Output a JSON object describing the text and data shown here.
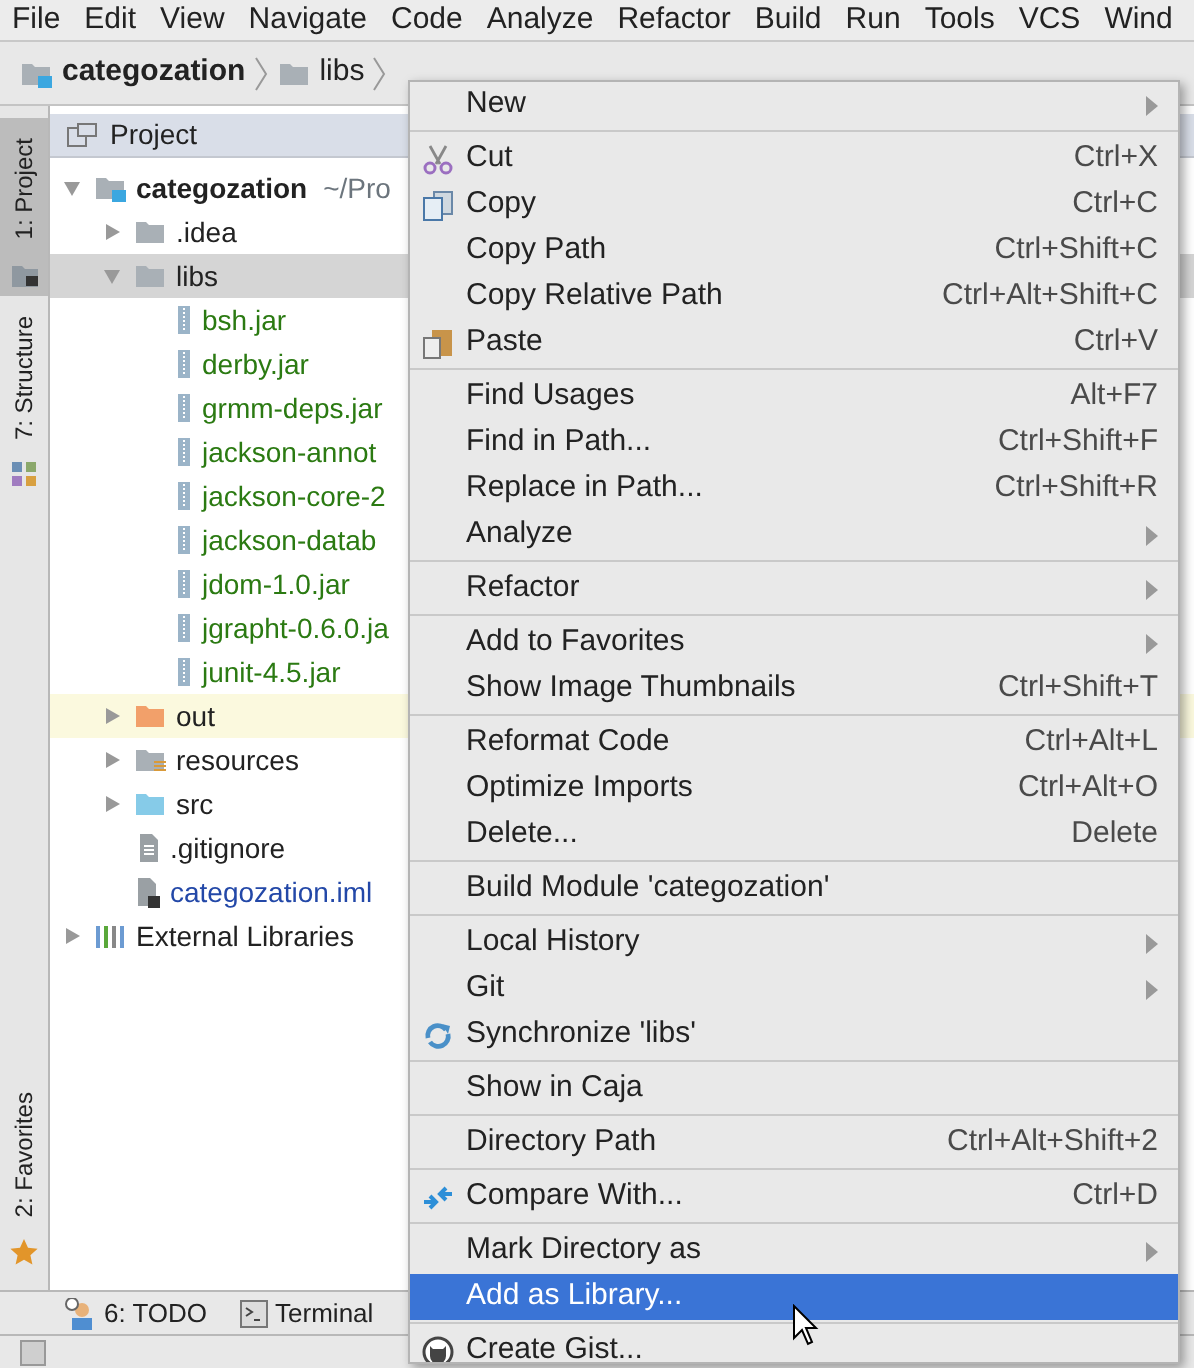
{
  "menu_bar": [
    "File",
    "Edit",
    "View",
    "Navigate",
    "Code",
    "Analyze",
    "Refactor",
    "Build",
    "Run",
    "Tools",
    "VCS",
    "Wind"
  ],
  "breadcrumb": [
    {
      "label": "categozation",
      "kind": "project"
    },
    {
      "label": "libs",
      "kind": "folder"
    }
  ],
  "tool_strip": [
    {
      "label": "1: Project",
      "kind": "project",
      "selected": true
    },
    {
      "label": "7: Structure",
      "kind": "structure",
      "selected": false
    }
  ],
  "tool_strip_bottom": [
    {
      "label": "2: Favorites",
      "kind": "favorites",
      "selected": false
    }
  ],
  "project_panel": {
    "title": "Project",
    "tree": [
      {
        "label": "categozation",
        "path": "~/Pro",
        "kind": "project",
        "expanded": true,
        "selected": false,
        "children": [
          {
            "label": ".idea",
            "kind": "folder",
            "expanded": false,
            "selected": false
          },
          {
            "label": "libs",
            "kind": "folder",
            "expanded": true,
            "selected": true,
            "children": [
              {
                "label": "bsh.jar",
                "kind": "jar",
                "selected": false
              },
              {
                "label": "derby.jar",
                "kind": "jar",
                "selected": false
              },
              {
                "label": "grmm-deps.jar",
                "kind": "jar",
                "selected": false
              },
              {
                "label": "jackson-annot",
                "kind": "jar",
                "selected": false
              },
              {
                "label": "jackson-core-2",
                "kind": "jar",
                "selected": false
              },
              {
                "label": "jackson-datab",
                "kind": "jar",
                "selected": false
              },
              {
                "label": "jdom-1.0.jar",
                "kind": "jar",
                "selected": false
              },
              {
                "label": "jgrapht-0.6.0.ja",
                "kind": "jar",
                "selected": false
              },
              {
                "label": "junit-4.5.jar",
                "kind": "jar",
                "selected": false
              }
            ]
          },
          {
            "label": "out",
            "kind": "excluded",
            "expanded": false,
            "selected": false
          },
          {
            "label": "resources",
            "kind": "resources",
            "expanded": false,
            "selected": false
          },
          {
            "label": "src",
            "kind": "source",
            "expanded": false,
            "selected": false
          },
          {
            "label": ".gitignore",
            "kind": "file",
            "selected": false
          },
          {
            "label": "categozation.iml",
            "kind": "module",
            "selected": false
          }
        ]
      },
      {
        "label": "External Libraries",
        "kind": "libraries",
        "expanded": false,
        "selected": false
      }
    ]
  },
  "bottom_tabs": [
    {
      "label": "6: TODO",
      "kind": "todo"
    },
    {
      "label": "Terminal",
      "kind": "terminal"
    }
  ],
  "context_menu": {
    "groups": [
      [
        {
          "label": "New",
          "submenu": true,
          "kind": "plain",
          "selected": false
        }
      ],
      [
        {
          "label": "Cut",
          "shortcut": "Ctrl+X",
          "submenu": false,
          "kind": "cut",
          "selected": false
        },
        {
          "label": "Copy",
          "shortcut": "Ctrl+C",
          "submenu": false,
          "kind": "copy",
          "selected": false
        },
        {
          "label": "Copy Path",
          "shortcut": "Ctrl+Shift+C",
          "submenu": false,
          "kind": "plain",
          "selected": false
        },
        {
          "label": "Copy Relative Path",
          "shortcut": "Ctrl+Alt+Shift+C",
          "submenu": false,
          "kind": "plain",
          "selected": false
        },
        {
          "label": "Paste",
          "shortcut": "Ctrl+V",
          "submenu": false,
          "kind": "paste",
          "selected": false
        }
      ],
      [
        {
          "label": "Find Usages",
          "shortcut": "Alt+F7",
          "submenu": false,
          "kind": "plain",
          "selected": false
        },
        {
          "label": "Find in Path...",
          "shortcut": "Ctrl+Shift+F",
          "submenu": false,
          "kind": "plain",
          "selected": false
        },
        {
          "label": "Replace in Path...",
          "shortcut": "Ctrl+Shift+R",
          "submenu": false,
          "kind": "plain",
          "selected": false
        },
        {
          "label": "Analyze",
          "submenu": true,
          "kind": "plain",
          "selected": false
        }
      ],
      [
        {
          "label": "Refactor",
          "submenu": true,
          "kind": "plain",
          "selected": false
        }
      ],
      [
        {
          "label": "Add to Favorites",
          "submenu": true,
          "kind": "plain",
          "selected": false
        },
        {
          "label": "Show Image Thumbnails",
          "shortcut": "Ctrl+Shift+T",
          "submenu": false,
          "kind": "plain",
          "selected": false
        }
      ],
      [
        {
          "label": "Reformat Code",
          "shortcut": "Ctrl+Alt+L",
          "submenu": false,
          "kind": "plain",
          "selected": false
        },
        {
          "label": "Optimize Imports",
          "shortcut": "Ctrl+Alt+O",
          "submenu": false,
          "kind": "plain",
          "selected": false
        },
        {
          "label": "Delete...",
          "shortcut": "Delete",
          "submenu": false,
          "kind": "plain",
          "selected": false
        }
      ],
      [
        {
          "label": "Build Module 'categozation'",
          "submenu": false,
          "kind": "plain",
          "selected": false
        }
      ],
      [
        {
          "label": "Local History",
          "submenu": true,
          "kind": "plain",
          "selected": false
        },
        {
          "label": "Git",
          "submenu": true,
          "kind": "plain",
          "selected": false
        },
        {
          "label": "Synchronize 'libs'",
          "submenu": false,
          "kind": "sync",
          "selected": false
        }
      ],
      [
        {
          "label": "Show in Caja",
          "submenu": false,
          "kind": "plain",
          "selected": false
        }
      ],
      [
        {
          "label": "Directory Path",
          "shortcut": "Ctrl+Alt+Shift+2",
          "submenu": false,
          "kind": "plain",
          "selected": false
        }
      ],
      [
        {
          "label": "Compare With...",
          "shortcut": "Ctrl+D",
          "submenu": false,
          "kind": "compare",
          "selected": false
        }
      ],
      [
        {
          "label": "Mark Directory as",
          "submenu": true,
          "kind": "plain",
          "selected": false
        },
        {
          "label": "Add as Library...",
          "submenu": false,
          "kind": "plain",
          "selected": true
        }
      ],
      [
        {
          "label": "Create Gist...",
          "submenu": false,
          "kind": "gist",
          "selected": false
        }
      ]
    ]
  }
}
